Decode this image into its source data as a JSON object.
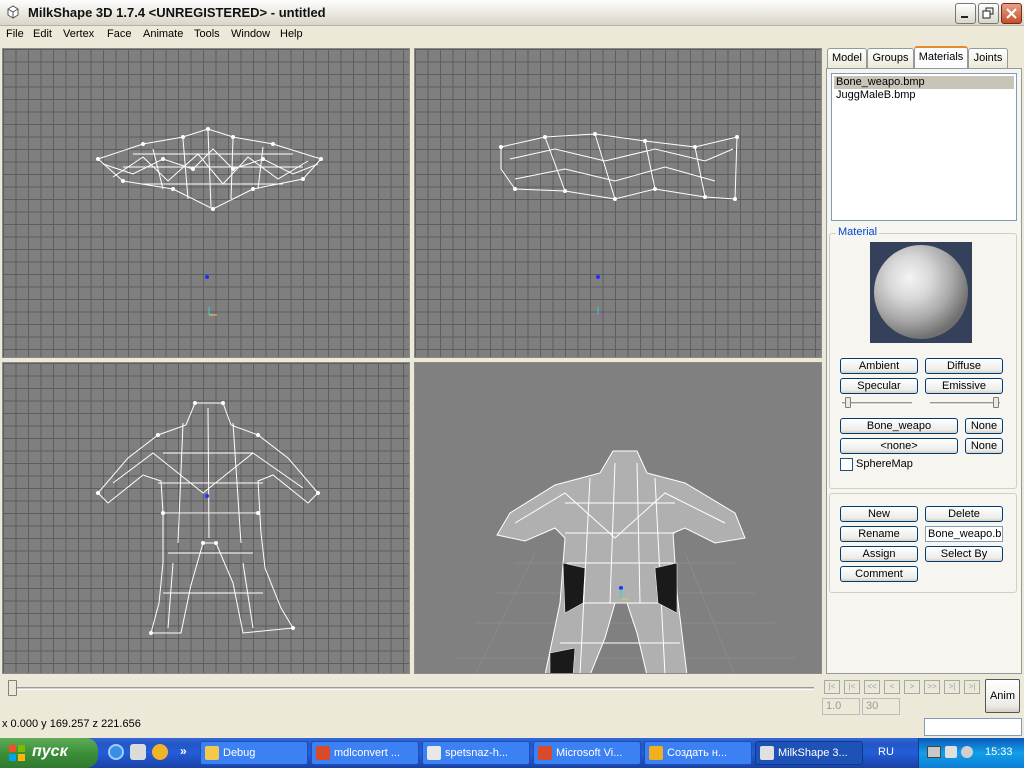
{
  "window": {
    "title": "MilkShape 3D 1.7.4 <UNREGISTERED> - untitled",
    "min_label": "minimize",
    "max_label": "maximize",
    "close_label": "close"
  },
  "menu": [
    "File",
    "Edit",
    "Vertex",
    "Face",
    "Animate",
    "Tools",
    "Window",
    "Help"
  ],
  "tabs": [
    "Model",
    "Groups",
    "Materials",
    "Joints"
  ],
  "active_tab": "Materials",
  "materials": {
    "items": [
      "Bone_weapo.bmp",
      "JuggMaleB.bmp"
    ],
    "selected_index": 0,
    "group_label": "Material",
    "ambient": "Ambient",
    "diffuse": "Diffuse",
    "specular": "Specular",
    "emissive": "Emissive",
    "slider_shininess": 0.05,
    "slider_transparency": 0.98,
    "texture1": "Bone_weapo",
    "texture1_none": "None",
    "texture2": "<none>",
    "texture2_none": "None",
    "spheremap": "SphereMap",
    "spheremap_checked": false,
    "new": "New",
    "delete": "Delete",
    "rename": "Rename",
    "name_value": "Bone_weapo.b",
    "assign": "Assign",
    "select_by": "Select By",
    "comment": "Comment"
  },
  "timeline": {
    "position": 0,
    "frame_start": "1.0",
    "frame_end": "30",
    "anim_label": "Anim"
  },
  "status": {
    "coords": "x 0.000 y 169.257 z 221.656"
  },
  "taskbar": {
    "start": "пуск",
    "chevron": "»",
    "tasks": [
      {
        "label": "Debug",
        "icon": "folder-icon",
        "color": "#f2c94c"
      },
      {
        "label": "mdlconvert ...",
        "icon": "app-icon",
        "color": "#d84a2a"
      },
      {
        "label": "spetsnaz-h...",
        "icon": "document-icon",
        "color": "#e8e8e8"
      },
      {
        "label": "Microsoft Vi...",
        "icon": "app-icon",
        "color": "#d84a2a"
      },
      {
        "label": "Создать н...",
        "icon": "browser-icon",
        "color": "#f0b020"
      },
      {
        "label": "MilkShape 3...",
        "icon": "milkshape-icon",
        "color": "#e0e0e0"
      }
    ],
    "lang": "RU",
    "clock": "15:33"
  }
}
